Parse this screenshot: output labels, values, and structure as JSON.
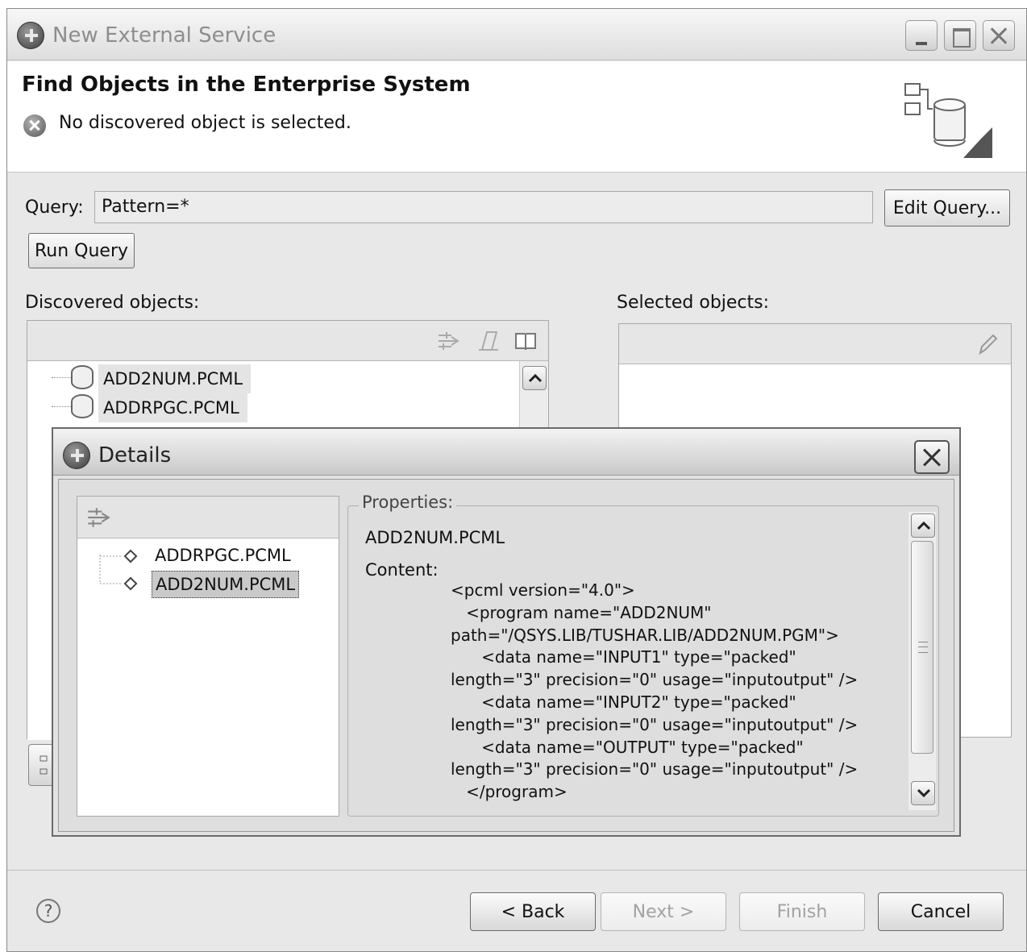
{
  "window": {
    "title": "New External Service"
  },
  "banner": {
    "title": "Find Objects in the Enterprise System",
    "message": "No discovered object is selected."
  },
  "query": {
    "label": "Query:",
    "value": "Pattern=*",
    "edit_button": "Edit Query...",
    "run_button": "Run Query"
  },
  "discovered": {
    "label": "Discovered objects:",
    "items": [
      "ADD2NUM.PCML",
      "ADDRPGC.PCML"
    ]
  },
  "selected": {
    "label": "Selected objects:"
  },
  "nav": {
    "back": "< Back",
    "next": "Next >",
    "finish": "Finish",
    "cancel": "Cancel",
    "help": "?"
  },
  "details": {
    "title": "Details",
    "tree_items": [
      "ADDRPGC.PCML",
      "ADD2NUM.PCML"
    ],
    "properties_legend": "Properties:",
    "object_name": "ADD2NUM.PCML",
    "content_label": "Content:",
    "content": "<pcml version=\"4.0\">\n   <program name=\"ADD2NUM\"\npath=\"/QSYS.LIB/TUSHAR.LIB/ADD2NUM.PGM\">\n      <data name=\"INPUT1\" type=\"packed\"\nlength=\"3\" precision=\"0\" usage=\"inputoutput\" />\n      <data name=\"INPUT2\" type=\"packed\"\nlength=\"3\" precision=\"0\" usage=\"inputoutput\" />\n      <data name=\"OUTPUT\" type=\"packed\"\nlength=\"3\" precision=\"0\" usage=\"inputoutput\" />\n   </program>"
  },
  "icons": {
    "app": "plug-icon",
    "error": "error-icon",
    "wizard": "database-wizard-icon",
    "db_item": "database-icon",
    "tree_item": "diamond-icon"
  }
}
